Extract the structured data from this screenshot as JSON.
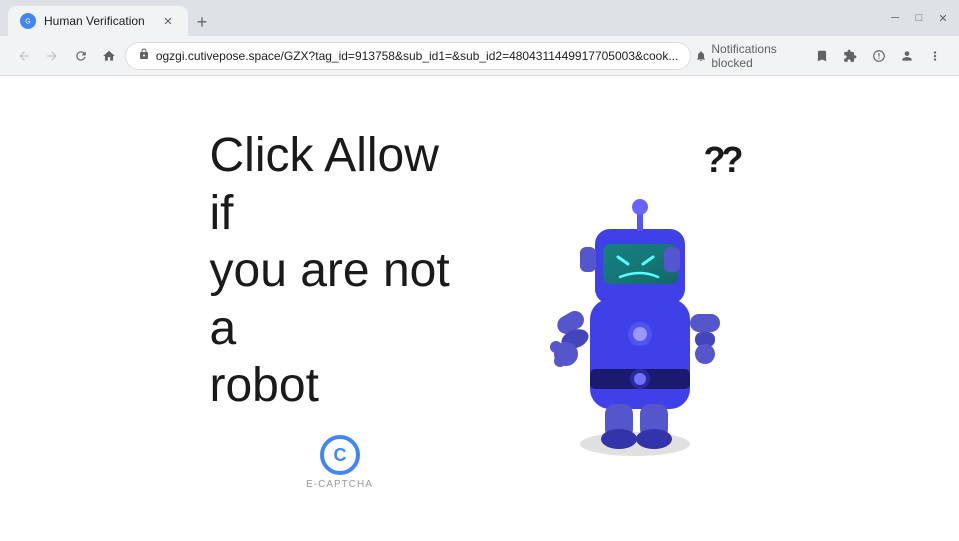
{
  "window": {
    "title": "Human Verification",
    "favicon_color": "#4285f4"
  },
  "titlebar": {
    "minimize": "─",
    "maximize": "□",
    "close": "✕",
    "new_tab": "+"
  },
  "toolbar": {
    "back": "←",
    "forward": "→",
    "reload": "↻",
    "home": "⌂",
    "url": "ogzgi.cutivepose.space/GZX?tag_id=913758&sub_id1=&sub_id2=4804311449917705003&cook...",
    "notifications_blocked": "Notifications blocked",
    "bookmark": "☆",
    "extensions": "🧩",
    "profile": "👤",
    "menu": "⋮"
  },
  "page": {
    "heading_line1": "Click Allow if",
    "heading_line2": "you are not a",
    "heading_line3": "robot",
    "captcha_label": "E-CAPTCHA",
    "question_marks": "??"
  }
}
